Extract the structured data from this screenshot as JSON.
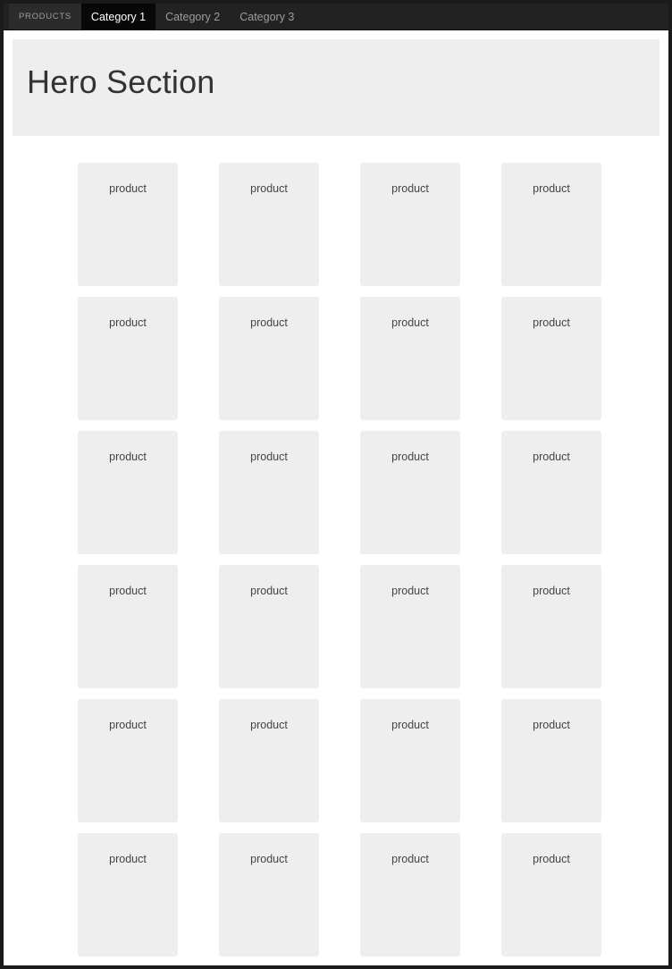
{
  "navbar": {
    "brand": "PRODUCTS",
    "tabs": [
      {
        "label": "Category 1",
        "active": true
      },
      {
        "label": "Category 2",
        "active": false
      },
      {
        "label": "Category 3",
        "active": false
      }
    ],
    "background_color": "#222222",
    "active_tab_color": "#080808",
    "inactive_text_color": "#9d9d9d"
  },
  "hero": {
    "title": "Hero Section",
    "background_color": "#eeeeee",
    "text_color": "#333333"
  },
  "product_grid": {
    "columns": 4,
    "rows": 6,
    "card_label": "product",
    "card_background_color": "#eeeeee",
    "cards": [
      {
        "label": "product"
      },
      {
        "label": "product"
      },
      {
        "label": "product"
      },
      {
        "label": "product"
      },
      {
        "label": "product"
      },
      {
        "label": "product"
      },
      {
        "label": "product"
      },
      {
        "label": "product"
      },
      {
        "label": "product"
      },
      {
        "label": "product"
      },
      {
        "label": "product"
      },
      {
        "label": "product"
      },
      {
        "label": "product"
      },
      {
        "label": "product"
      },
      {
        "label": "product"
      },
      {
        "label": "product"
      },
      {
        "label": "product"
      },
      {
        "label": "product"
      },
      {
        "label": "product"
      },
      {
        "label": "product"
      },
      {
        "label": "product"
      },
      {
        "label": "product"
      },
      {
        "label": "product"
      },
      {
        "label": "product"
      }
    ]
  }
}
